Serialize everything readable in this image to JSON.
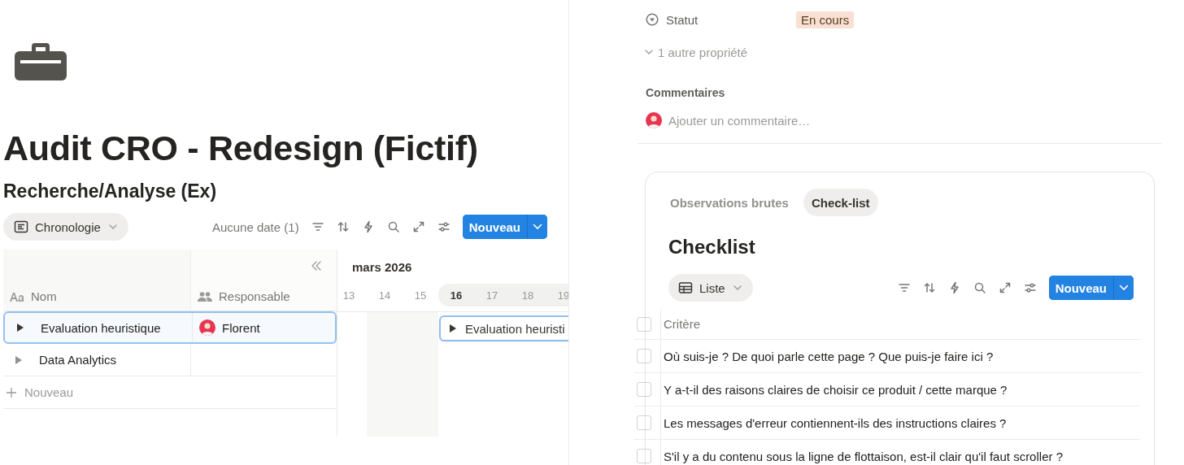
{
  "page": {
    "title": "Audit CRO - Redesign (Fictif)"
  },
  "database": {
    "title": "Recherche/Analyse (Ex)",
    "view": {
      "label": "Chronologie"
    },
    "no_date": "Aucune date (1)",
    "new_button": "Nouveau",
    "columns": [
      "Nom",
      "Responsable"
    ],
    "month": "mars 2026",
    "days": [
      {
        "label": "13",
        "weekend": false,
        "selected": false,
        "highlighted": false
      },
      {
        "label": "14",
        "weekend": true,
        "selected": false,
        "highlighted": false
      },
      {
        "label": "15",
        "weekend": true,
        "selected": false,
        "highlighted": false
      },
      {
        "label": "16",
        "weekend": false,
        "selected": true,
        "highlighted": true
      },
      {
        "label": "17",
        "weekend": false,
        "selected": false,
        "highlighted": true
      },
      {
        "label": "18",
        "weekend": false,
        "selected": false,
        "highlighted": true
      },
      {
        "label": "19",
        "weekend": false,
        "selected": false,
        "highlighted": true
      }
    ],
    "rows": [
      {
        "name": "Evaluation heuristique",
        "selected": true,
        "assignee": "Florent",
        "bar": "Evaluation heuristi"
      },
      {
        "name": "Data Analytics",
        "selected": false
      }
    ],
    "add_row": "Nouveau"
  },
  "properties": [
    {
      "label": "Statut",
      "value": "En cours",
      "color": "#f8e0d2"
    }
  ],
  "more_properties": "1 autre propriété",
  "comments": {
    "title": "Commentaires",
    "placeholder": "Ajouter un commentaire…"
  },
  "linked": {
    "tabs": [
      {
        "label": "Observations brutes",
        "selected": false
      },
      {
        "label": "Check-list",
        "selected": true
      }
    ],
    "title": "Checklist",
    "view": {
      "label": "Liste"
    },
    "new_button": "Nouveau",
    "header": {
      "label": "Critère",
      "checked": false
    },
    "items": [
      {
        "label": "Où suis-je ? De quoi parle cette page ? Que puis-je faire ici ?",
        "checked": false
      },
      {
        "label": "Y a-t-il des raisons claires de choisir ce produit / cette marque ?",
        "checked": false
      },
      {
        "label": "Les messages d'erreur contiennent-ils des instructions claires ?",
        "checked": false
      },
      {
        "label": "S'il y a du contenu sous la ligne de flottaison, est-il clair qu'il faut scroller ?",
        "checked": false
      }
    ]
  }
}
